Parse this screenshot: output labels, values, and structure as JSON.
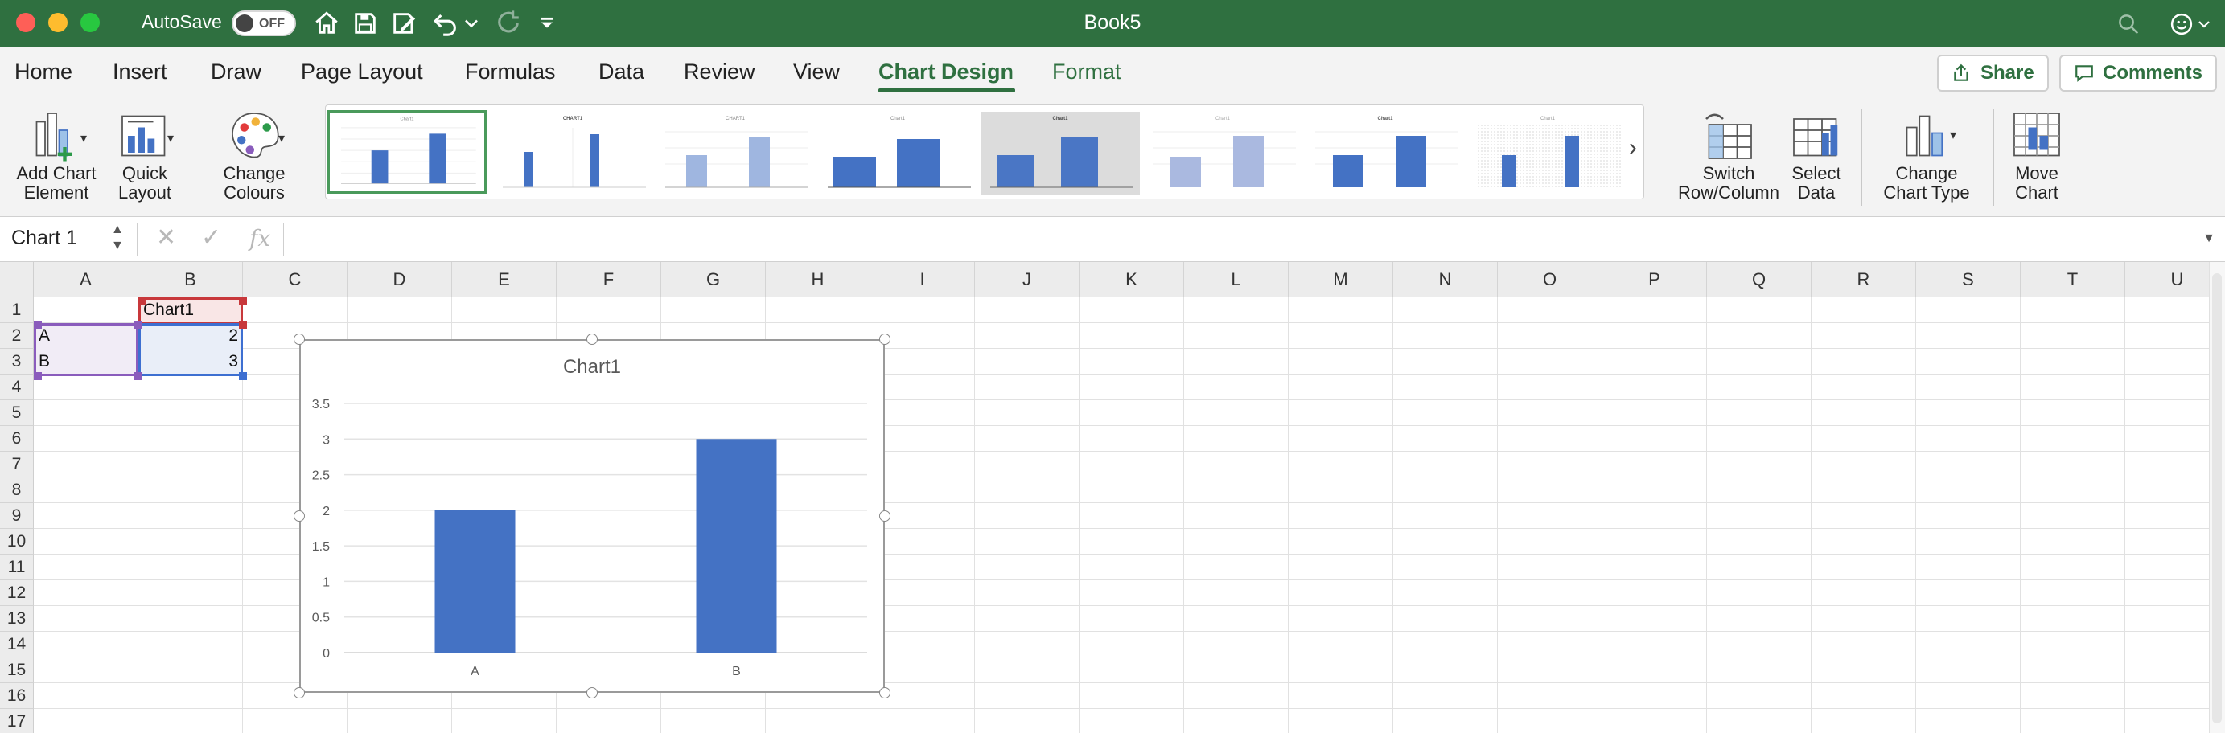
{
  "window": {
    "title": "Book5",
    "autosave_label": "AutoSave",
    "autosave_state": "OFF"
  },
  "tabs": [
    {
      "label": "Home"
    },
    {
      "label": "Insert"
    },
    {
      "label": "Draw"
    },
    {
      "label": "Page Layout"
    },
    {
      "label": "Formulas"
    },
    {
      "label": "Data"
    },
    {
      "label": "Review"
    },
    {
      "label": "View"
    },
    {
      "label": "Chart Design",
      "active": true
    },
    {
      "label": "Format"
    }
  ],
  "header_buttons": {
    "share": "Share",
    "comments": "Comments"
  },
  "ribbon": {
    "add_chart_element": [
      "Add Chart",
      "Element"
    ],
    "quick_layout": [
      "Quick",
      "Layout"
    ],
    "change_colours": [
      "Change",
      "Colours"
    ],
    "switch_row_column": [
      "Switch",
      "Row/Column"
    ],
    "select_data": [
      "Select",
      "Data"
    ],
    "change_chart_type": [
      "Change",
      "Chart Type"
    ],
    "move_chart": [
      "Move",
      "Chart"
    ],
    "chart_styles_count": 8,
    "selected_style": 1
  },
  "formula_bar": {
    "name_box": "Chart 1",
    "fx": "fx",
    "formula": ""
  },
  "grid": {
    "columns": [
      "A",
      "B",
      "C",
      "D",
      "E",
      "F",
      "G",
      "H",
      "I",
      "J",
      "K",
      "L",
      "M",
      "N",
      "O",
      "P",
      "Q",
      "R",
      "S",
      "T",
      "U"
    ],
    "rows": [
      "1",
      "2",
      "3",
      "4",
      "5",
      "6",
      "7",
      "8",
      "9",
      "10",
      "11",
      "12",
      "13",
      "14",
      "15",
      "16",
      "17"
    ],
    "cells": {
      "B1": "Chart1",
      "A2": "A",
      "B2": "2",
      "A3": "B",
      "B3": "3"
    }
  },
  "chart_data": {
    "type": "bar",
    "title": "Chart1",
    "categories": [
      "A",
      "B"
    ],
    "values": [
      2,
      3
    ],
    "series": [
      {
        "name": "Chart1",
        "values": [
          2,
          3
        ]
      }
    ],
    "ylim": [
      0,
      3.5
    ],
    "yticks": [
      "0",
      "0.5",
      "1",
      "1.5",
      "2",
      "2.5",
      "3",
      "3.5"
    ],
    "grid": true,
    "legend": "none",
    "bar_color": "#4472c4"
  },
  "colors": {
    "titlebar": "#2f7040",
    "accent": "#2f7040",
    "bar": "#4472c4"
  }
}
